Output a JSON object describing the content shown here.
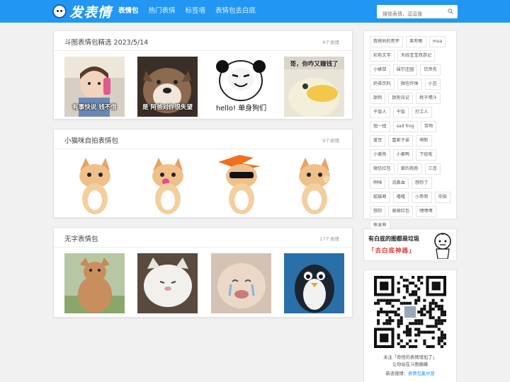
{
  "header": {
    "logo_text": "发表情",
    "nav": [
      {
        "label": "表情包",
        "active": true
      },
      {
        "label": "热门表情",
        "active": false
      },
      {
        "label": "标签墙",
        "active": false
      },
      {
        "label": "表情包去白底",
        "active": false
      }
    ],
    "search_placeholder": "搜锁表情，逗逗搜"
  },
  "sections": [
    {
      "title": "斗图表情包精选 2023/5/14",
      "count": "9个表情",
      "captions": [
        "有事快说 钱不借",
        "是 阿爸对你很失望",
        "hello! 单身狗们",
        "哥，你咋又赚钱了"
      ]
    },
    {
      "title": "小猫咪自拍表情包",
      "count": "9个表情",
      "captions": []
    },
    {
      "title": "无字表情包",
      "count": "17个表情",
      "captions": []
    }
  ],
  "tags": [
    "我爸妈的死怀",
    "离有眠",
    "mua",
    "彩色文字",
    "天线宝宝西游记",
    "小蜂鼠",
    "屎尔庄园",
    "饮吊先",
    "奶茶饮料",
    "微信炸弹",
    "小丑",
    "舔狗",
    "舔狗日记",
    "耗子喂汁",
    "干饭人",
    "干饭",
    "打工人",
    "扭一扭",
    "sad frog",
    "舌吻",
    "爱豆",
    "富家子弟",
    "萌新",
    "小黄狗",
    "小黄鸭",
    "下班啦",
    "微信红包",
    "爱的抱抱",
    "三连",
    "咧咪",
    "流鼻血",
    "想你了",
    "狐猫萌",
    "嘻嘻",
    "小哥哥",
    "中指",
    "想你",
    "谢谢红包",
    "嘿嘿嘿",
    "熊本熊"
  ],
  "ad": {
    "line1": "有白底的图都是垃圾",
    "line2": "「去白底神器」"
  },
  "qr": {
    "line1": "关注「奇怪的表情增加了」",
    "line2": "让你站在斗图巅峰",
    "weibo_label": "新浪微博：",
    "weibo_link": "表情包集中营"
  }
}
